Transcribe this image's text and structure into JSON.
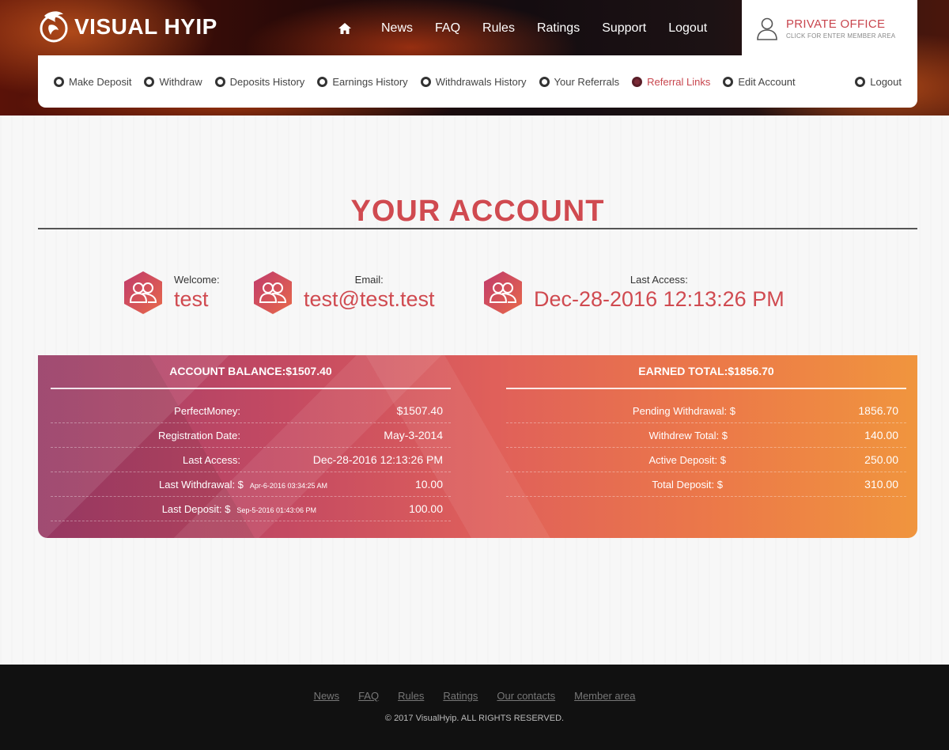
{
  "brand": {
    "name": "VISUAL HYIP"
  },
  "topnav": {
    "items": [
      "News",
      "FAQ",
      "Rules",
      "Ratings",
      "Support",
      "Logout"
    ]
  },
  "private_office": {
    "title": "PRIVATE OFFICE",
    "subtitle": "CLICK FOR ENTER MEMBER AREA"
  },
  "subnav": {
    "items": [
      "Make Deposit",
      "Withdraw",
      "Deposits History",
      "Earnings History",
      "Withdrawals History",
      "Your Referrals",
      "Referral Links",
      "Edit Account"
    ],
    "active": "Referral Links",
    "logout": "Logout"
  },
  "page": {
    "title": "YOUR ACCOUNT"
  },
  "info": {
    "welcome_label": "Welcome:",
    "welcome_value": "test",
    "email_label": "Email:",
    "email_value": "test@test.test",
    "last_access_label": "Last Access:",
    "last_access_value": "Dec-28-2016 12:13:26 PM"
  },
  "balance": {
    "heading": "ACCOUNT BALANCE:$1507.40",
    "rows": [
      {
        "label": "PerfectMoney:",
        "note": "",
        "value": "$1507.40"
      },
      {
        "label": "Registration Date:",
        "note": "",
        "value": "May-3-2014"
      },
      {
        "label": "Last Access:",
        "note": "",
        "value": "Dec-28-2016 12:13:26 PM"
      },
      {
        "label": "Last Withdrawal: $",
        "note": "Apr-6-2016 03:34:25 AM",
        "value": "10.00"
      },
      {
        "label": "Last Deposit: $",
        "note": "Sep-5-2016 01:43:06 PM",
        "value": "100.00"
      }
    ]
  },
  "earned": {
    "heading": "EARNED TOTAL:$1856.70",
    "rows": [
      {
        "label": "Pending Withdrawal: $",
        "value": "1856.70"
      },
      {
        "label": "Withdrew Total: $",
        "value": "140.00"
      },
      {
        "label": "Active Deposit: $",
        "value": "250.00"
      },
      {
        "label": "Total Deposit: $",
        "value": "310.00"
      }
    ]
  },
  "footer": {
    "links": [
      "News",
      "FAQ",
      "Rules",
      "Ratings",
      "Our contacts",
      "Member area"
    ],
    "copyright": "© 2017 VisualHyip. ALL RIGHTS RESERVED."
  },
  "colors": {
    "accent": "#d04a50",
    "footer_bg": "#111111",
    "active_dot": "#7a2a36"
  }
}
